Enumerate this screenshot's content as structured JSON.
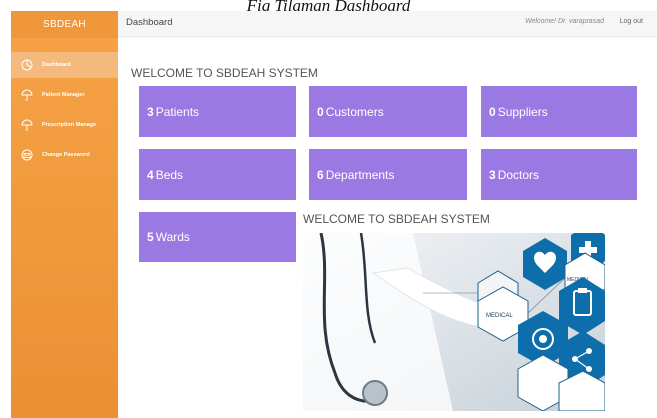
{
  "caption": "Fig Tilaman Dashboard",
  "sidebar": {
    "brand": "SBDEAH",
    "items": [
      {
        "label": "Dashboard",
        "icon": "dashboard-icon"
      },
      {
        "label": "Patient Manager",
        "icon": "umbrella-icon"
      },
      {
        "label": "Prescription Manage",
        "icon": "umbrella-icon"
      },
      {
        "label": "Change Password",
        "icon": "envelope-icon"
      }
    ]
  },
  "topbar": {
    "title": "Dashboard",
    "welcome": "Welcome! Dr. varaprasad",
    "logout": "Log out"
  },
  "main": {
    "heading": "WELCOME TO SBDEAH SYSTEM",
    "tiles": [
      {
        "count": "3",
        "label": "Patients"
      },
      {
        "count": "0",
        "label": "Customers"
      },
      {
        "count": "0",
        "label": "Suppliers"
      },
      {
        "count": "4",
        "label": "Beds"
      },
      {
        "count": "6",
        "label": "Departments"
      },
      {
        "count": "3",
        "label": "Doctors"
      },
      {
        "count": "5",
        "label": "Wards"
      }
    ],
    "image_heading": "WELCOME TO SBDEAH SYSTEM",
    "image_labels": [
      "MEDICAL",
      "MEDICAL"
    ]
  },
  "colors": {
    "sidebar": "#f09b3e",
    "sidebar_active": "#f4ba7d",
    "tile": "#9b79e3"
  }
}
